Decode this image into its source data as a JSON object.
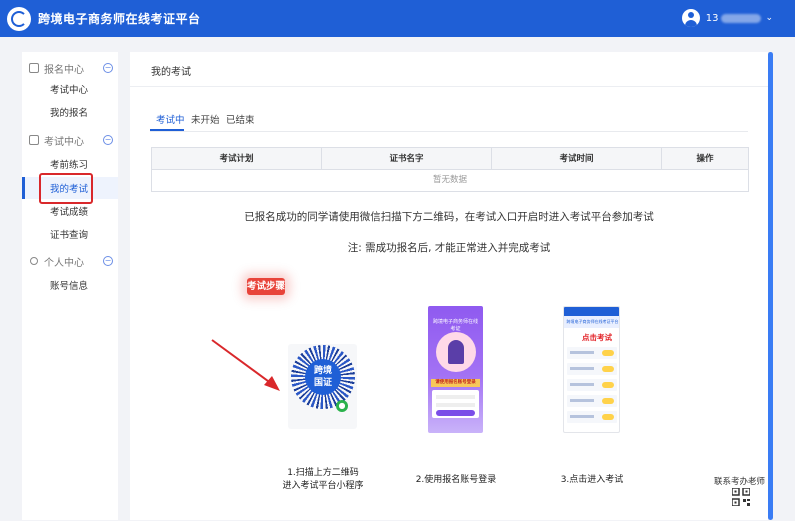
{
  "header": {
    "brand": "跨境电子商务师在线考证平台",
    "user_prefix": "13"
  },
  "sidebar": {
    "sections": [
      {
        "label": "报名中心",
        "items": [
          {
            "label": "考试中心"
          },
          {
            "label": "我的报名"
          }
        ]
      },
      {
        "label": "考试中心",
        "items": [
          {
            "label": "考前练习"
          },
          {
            "label": "我的考试",
            "active": true
          },
          {
            "label": "考试成绩"
          },
          {
            "label": "证书查询"
          }
        ]
      },
      {
        "label": "个人中心",
        "items": [
          {
            "label": "账号信息"
          }
        ]
      }
    ]
  },
  "main": {
    "title": "我的考试",
    "tabs": [
      {
        "label": "考试中",
        "active": true
      },
      {
        "label": "未开始"
      },
      {
        "label": "已结束"
      }
    ],
    "table": {
      "columns": [
        "考试计划",
        "证书名字",
        "考试时间",
        "操作"
      ],
      "empty_text": "暂无数据"
    },
    "note_primary": "已报名成功的同学请使用微信扫描下方二维码，在考试入口开启时进入考试平台参加考试",
    "note_secondary": "注: 需成功报名后, 才能正常进入并完成考试",
    "steps_badge": "考试步骤",
    "steps": [
      {
        "caption_line1": "1.扫描上方二维码",
        "caption_line2": "进入考试平台小程序",
        "image": {
          "center_line1": "跨境",
          "center_line2": "国证"
        }
      },
      {
        "caption_line1": "2.使用报名账号登录",
        "image": {
          "title": "跨境电子商务师在线考证",
          "banner": "请使用报名账号登录"
        }
      },
      {
        "caption_line1": "3.点击进入考试",
        "image": {
          "subtitle": "跨境电子商务师在线考证平台",
          "headline": "点击考试"
        }
      }
    ],
    "contact_label": "联系考办老师"
  },
  "colors": {
    "primary": "#1f5fd6",
    "highlight_red": "#d9282b",
    "badge_red": "#e8443a",
    "page_bg": "#f2f3f7"
  },
  "icons": {
    "logo": "platform-logo-icon",
    "user": "user-avatar-icon",
    "section_toggle": "collapse-circle-icon",
    "wechat": "wechat-icon",
    "contact": "qr-code-icon"
  }
}
